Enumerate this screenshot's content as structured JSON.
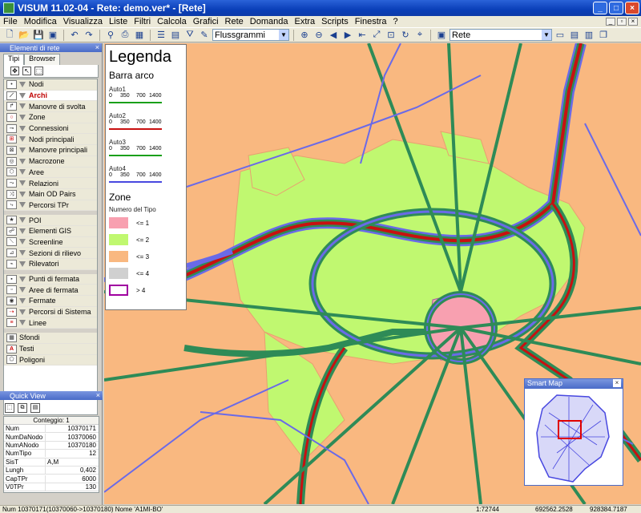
{
  "window": {
    "title": "VISUM 11.02-04 - Rete: demo.ver* - [Rete]",
    "buttons": [
      "_",
      "□",
      "×"
    ]
  },
  "menu": {
    "items": [
      "File",
      "Modifica",
      "Visualizza",
      "Liste",
      "Filtri",
      "Calcola",
      "Grafici",
      "Rete",
      "Domanda",
      "Extra",
      "Scripts",
      "Finestra",
      "?"
    ]
  },
  "toolbar": {
    "graph_combo": "Flussgrammi",
    "view_combo": "Rete"
  },
  "left_panel": {
    "header": "Elementi di rete",
    "tabs": [
      "Tipi",
      "Browser"
    ],
    "layers": [
      "Nodi",
      "Archi",
      "Manovre di svolta",
      "Zone",
      "Connessioni",
      "Nodi principali",
      "Manovre principali",
      "Macrozone",
      "Aree",
      "Relazioni",
      "Main OD Pairs",
      "Percorsi TPr",
      "POI",
      "Elementi GIS",
      "Screenline",
      "Sezioni di rilievo",
      "Rilevatori",
      "Punti di fermata",
      "Aree di fermata",
      "Fermate",
      "Percorsi di Sistema",
      "Linee",
      "Sfondi",
      "Testi",
      "Poligoni"
    ],
    "selected_layer": "Archi"
  },
  "quick_view": {
    "header": "Quick View",
    "caption": "Conteggio: 1",
    "rows": [
      {
        "key": "Num",
        "value": "10370171"
      },
      {
        "key": "NumDaNodo",
        "value": "10370060"
      },
      {
        "key": "NumANodo",
        "value": "10370180"
      },
      {
        "key": "NumTipo",
        "value": "12"
      },
      {
        "key": "SisT",
        "value": "A,M"
      },
      {
        "key": "Lungh",
        "value": "0,402"
      },
      {
        "key": "CapTPr",
        "value": "6000"
      },
      {
        "key": "V0TPr",
        "value": "130"
      }
    ]
  },
  "legend": {
    "title": "Legenda",
    "section_arcs": "Barra arco",
    "arc_scales": [
      {
        "name": "Auto1",
        "color": "#1aa01a",
        "ticks": [
          "0",
          "350",
          "700",
          "1400"
        ]
      },
      {
        "name": "Auto2",
        "color": "#c81010",
        "ticks": [
          "0",
          "350",
          "700",
          "1400"
        ]
      },
      {
        "name": "Auto3",
        "color": "#1aa01a",
        "ticks": [
          "0",
          "350",
          "700",
          "1400"
        ]
      },
      {
        "name": "Auto4",
        "color": "#4848e0",
        "ticks": [
          "0",
          "350",
          "700",
          "1400"
        ]
      }
    ],
    "section_zones": "Zone",
    "zones_subtitle": "Numero del Tipo",
    "zone_classes": [
      {
        "label": "<= 1",
        "color": "#f8a0b0"
      },
      {
        "label": "<= 2",
        "color": "#c0f870"
      },
      {
        "label": "<= 3",
        "color": "#f9b880"
      },
      {
        "label": "<= 4",
        "color": "#d0d0d0"
      },
      {
        "label": "> 4",
        "color": "#ffffff",
        "border": "#a000a0"
      }
    ]
  },
  "smart_map": {
    "title": "Smart Map"
  },
  "status_bar": {
    "selection": "Num 10370171(10370060->10370180)  Nome 'A1MI-BO'",
    "scale": "1:72744",
    "x": "692562.2528",
    "y": "928384.7187"
  },
  "colors": {
    "zone_orange": "#f9b880",
    "zone_green": "#c0f870",
    "zone_pink": "#f8a0b0",
    "link_green": "#2e8b57",
    "link_blue": "#6a6ae8",
    "link_red": "#c81010"
  }
}
